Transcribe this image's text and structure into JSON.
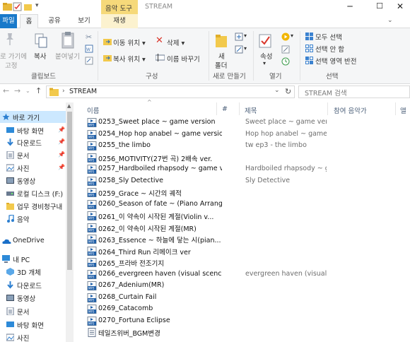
{
  "window": {
    "title": "STREAM",
    "contextual_tab_header": "음악 도구",
    "controls": [
      "─",
      "☐",
      "✕"
    ]
  },
  "ribbon_tabs": [
    "파일",
    "홈",
    "공유",
    "보기",
    "재생"
  ],
  "ribbon": {
    "clipboard": {
      "pin_label_line1": "로 가기에",
      "pin_label_line2": "고정",
      "copy": "복사",
      "paste": "붙여넣기",
      "group": "클립보드"
    },
    "organize": {
      "move_to": "이동 위치 ▾",
      "copy_to": "복사 위치 ▾",
      "delete": "삭제 ▾",
      "rename": "이름 바꾸기",
      "group": "구성"
    },
    "new": {
      "new_folder_line1": "새",
      "new_folder_line2": "폴더",
      "group": "새로 만들기"
    },
    "open": {
      "properties": "속성",
      "group": "열기"
    },
    "select": {
      "select_all": "모두 선택",
      "select_none": "선택 안 함",
      "invert": "선택 영역 반전",
      "group": "선택"
    }
  },
  "address": {
    "path": "STREAM",
    "search_placeholder": "STREAM 검색"
  },
  "nav": {
    "items": [
      {
        "label": "바로 가기",
        "icon": "star-icon",
        "pinned": false
      },
      {
        "label": "바탕 화면",
        "icon": "desktop-icon",
        "pinned": true
      },
      {
        "label": "다운로드",
        "icon": "download-icon",
        "pinned": true
      },
      {
        "label": "문서",
        "icon": "document-icon",
        "pinned": true
      },
      {
        "label": "사진",
        "icon": "picture-icon",
        "pinned": true
      },
      {
        "label": "동영상",
        "icon": "video-icon",
        "pinned": false
      },
      {
        "label": "로컬 디스크 (F:)",
        "icon": "drive-icon",
        "pinned": false
      },
      {
        "label": "업무 경비청구내",
        "icon": "folder-icon",
        "pinned": false
      },
      {
        "label": "음악",
        "icon": "music-icon",
        "pinned": false
      },
      {
        "label": "OneDrive",
        "icon": "cloud-icon",
        "pinned": false
      },
      {
        "label": "내 PC",
        "icon": "pc-icon",
        "pinned": false
      },
      {
        "label": "3D 개체",
        "icon": "cube-icon",
        "pinned": false
      },
      {
        "label": "다운로드",
        "icon": "download-icon",
        "pinned": false
      },
      {
        "label": "동영상",
        "icon": "video-icon",
        "pinned": false
      },
      {
        "label": "문서",
        "icon": "document-icon",
        "pinned": false
      },
      {
        "label": "바탕 화면",
        "icon": "desktop-icon",
        "pinned": false
      },
      {
        "label": "사진",
        "icon": "picture-icon",
        "pinned": false
      }
    ]
  },
  "columns": {
    "name": "이름",
    "number": "#",
    "title": "제목",
    "artist": "참여 음악가",
    "album": "앨"
  },
  "files": [
    {
      "name": "0253_Sweet place ~ game version",
      "title": "Sweet place ~ game vers..."
    },
    {
      "name": "0254_Hop hop anabel ~ game version",
      "title": "Hop hop anabel ~ game ..."
    },
    {
      "name": "0255_the limbo",
      "title": "tw ep3 - the limbo"
    },
    {
      "name": "0256_MOTIVITY(27번 곡) 2배속 ver.",
      "title": ""
    },
    {
      "name": "0257_Hardboiled rhapsody ~ game v...",
      "title": "Hardboiled rhapsody ~ g..."
    },
    {
      "name": "0258_Sly Detective",
      "title": "Sly Detective"
    },
    {
      "name": "0259_Grace ~ 시간의 궤적",
      "title": ""
    },
    {
      "name": "0260_Season of fate ~ (Piano Arrang...",
      "title": ""
    },
    {
      "name": "0261_이 약속이 시작된 계절(Violin v...",
      "title": ""
    },
    {
      "name": "0262_이 약속이 시작된 계절(MR)",
      "title": ""
    },
    {
      "name": "0263_Essence ~ 하늘에 닿는 시(pian...",
      "title": ""
    },
    {
      "name": "0264_Third Run 리메이크 ver",
      "title": ""
    },
    {
      "name": "0265_프라바 전조기지",
      "title": ""
    },
    {
      "name": "0266_evergreen haven (visual scence...",
      "title": "evergreen haven (visual s..."
    },
    {
      "name": "0267_Adenium(MR)",
      "title": ""
    },
    {
      "name": "0268_Curtain Fail",
      "title": ""
    },
    {
      "name": "0269_Catacomb",
      "title": ""
    },
    {
      "name": "0270_Fortuna Eclipse",
      "title": ""
    },
    {
      "name": "테일즈위버_BGM변경",
      "title": "",
      "icon": "text-file-icon"
    }
  ],
  "colors": {
    "accent": "#1979ca",
    "music_tool": "#f6d97a",
    "selection": "#cce8ff"
  }
}
